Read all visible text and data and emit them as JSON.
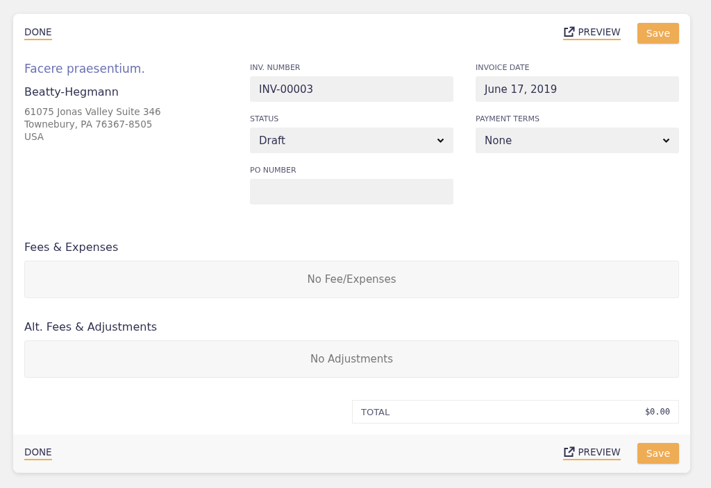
{
  "top_bar": {
    "done": "DONE",
    "preview": "PREVIEW",
    "save": "Save"
  },
  "client": {
    "title": "Facere praesentium.",
    "name": "Beatty-Hegmann",
    "address_lines": [
      "61075 Jonas Valley Suite 346",
      "Townebury, PA 76367-8505",
      "USA"
    ]
  },
  "fields": [
    {
      "label": "INV. NUMBER",
      "value": "INV-00003",
      "kind": "text"
    },
    {
      "label": "INVOICE DATE",
      "value": "June 17, 2019",
      "kind": "text"
    },
    {
      "label": "STATUS",
      "value": "Draft",
      "kind": "select"
    },
    {
      "label": "PAYMENT TERMS",
      "value": "None",
      "kind": "select"
    },
    {
      "label": "PO NUMBER",
      "kind": "text"
    }
  ],
  "sections": [
    {
      "heading": "Fees & Expenses",
      "empty_text": "No Fee/Expenses"
    },
    {
      "heading": "Alt. Fees & Adjustments",
      "empty_text": "No Adjustments"
    }
  ],
  "total": {
    "label": "TOTAL",
    "value": "$0.00"
  },
  "bottom_bar": {
    "done": "DONE",
    "preview": "PREVIEW",
    "save": "Save"
  }
}
